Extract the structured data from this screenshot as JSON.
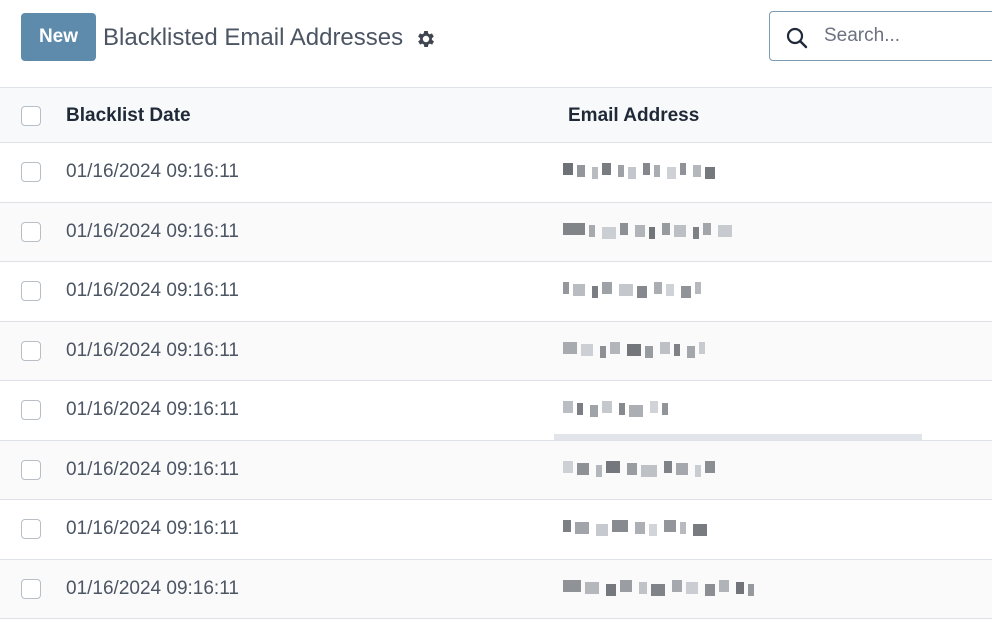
{
  "toolbar": {
    "new_label": "New",
    "title": "Blacklisted Email Addresses",
    "search_placeholder": "Search..."
  },
  "table": {
    "columns": [
      "Blacklist Date",
      "Email Address"
    ],
    "rows": [
      {
        "date": "01/16/2024 09:16:11"
      },
      {
        "date": "01/16/2024 09:16:11"
      },
      {
        "date": "01/16/2024 09:16:11"
      },
      {
        "date": "01/16/2024 09:16:11"
      },
      {
        "date": "01/16/2024 09:16:11"
      },
      {
        "date": "01/16/2024 09:16:11"
      },
      {
        "date": "01/16/2024 09:16:11"
      },
      {
        "date": "01/16/2024 09:16:11"
      }
    ]
  },
  "colors": {
    "accent": "#5e8bab",
    "header_bg": "#f8f9fa",
    "border": "#dee2e6"
  },
  "icons": [
    "gear-icon",
    "search-icon",
    "checkbox-icon"
  ]
}
